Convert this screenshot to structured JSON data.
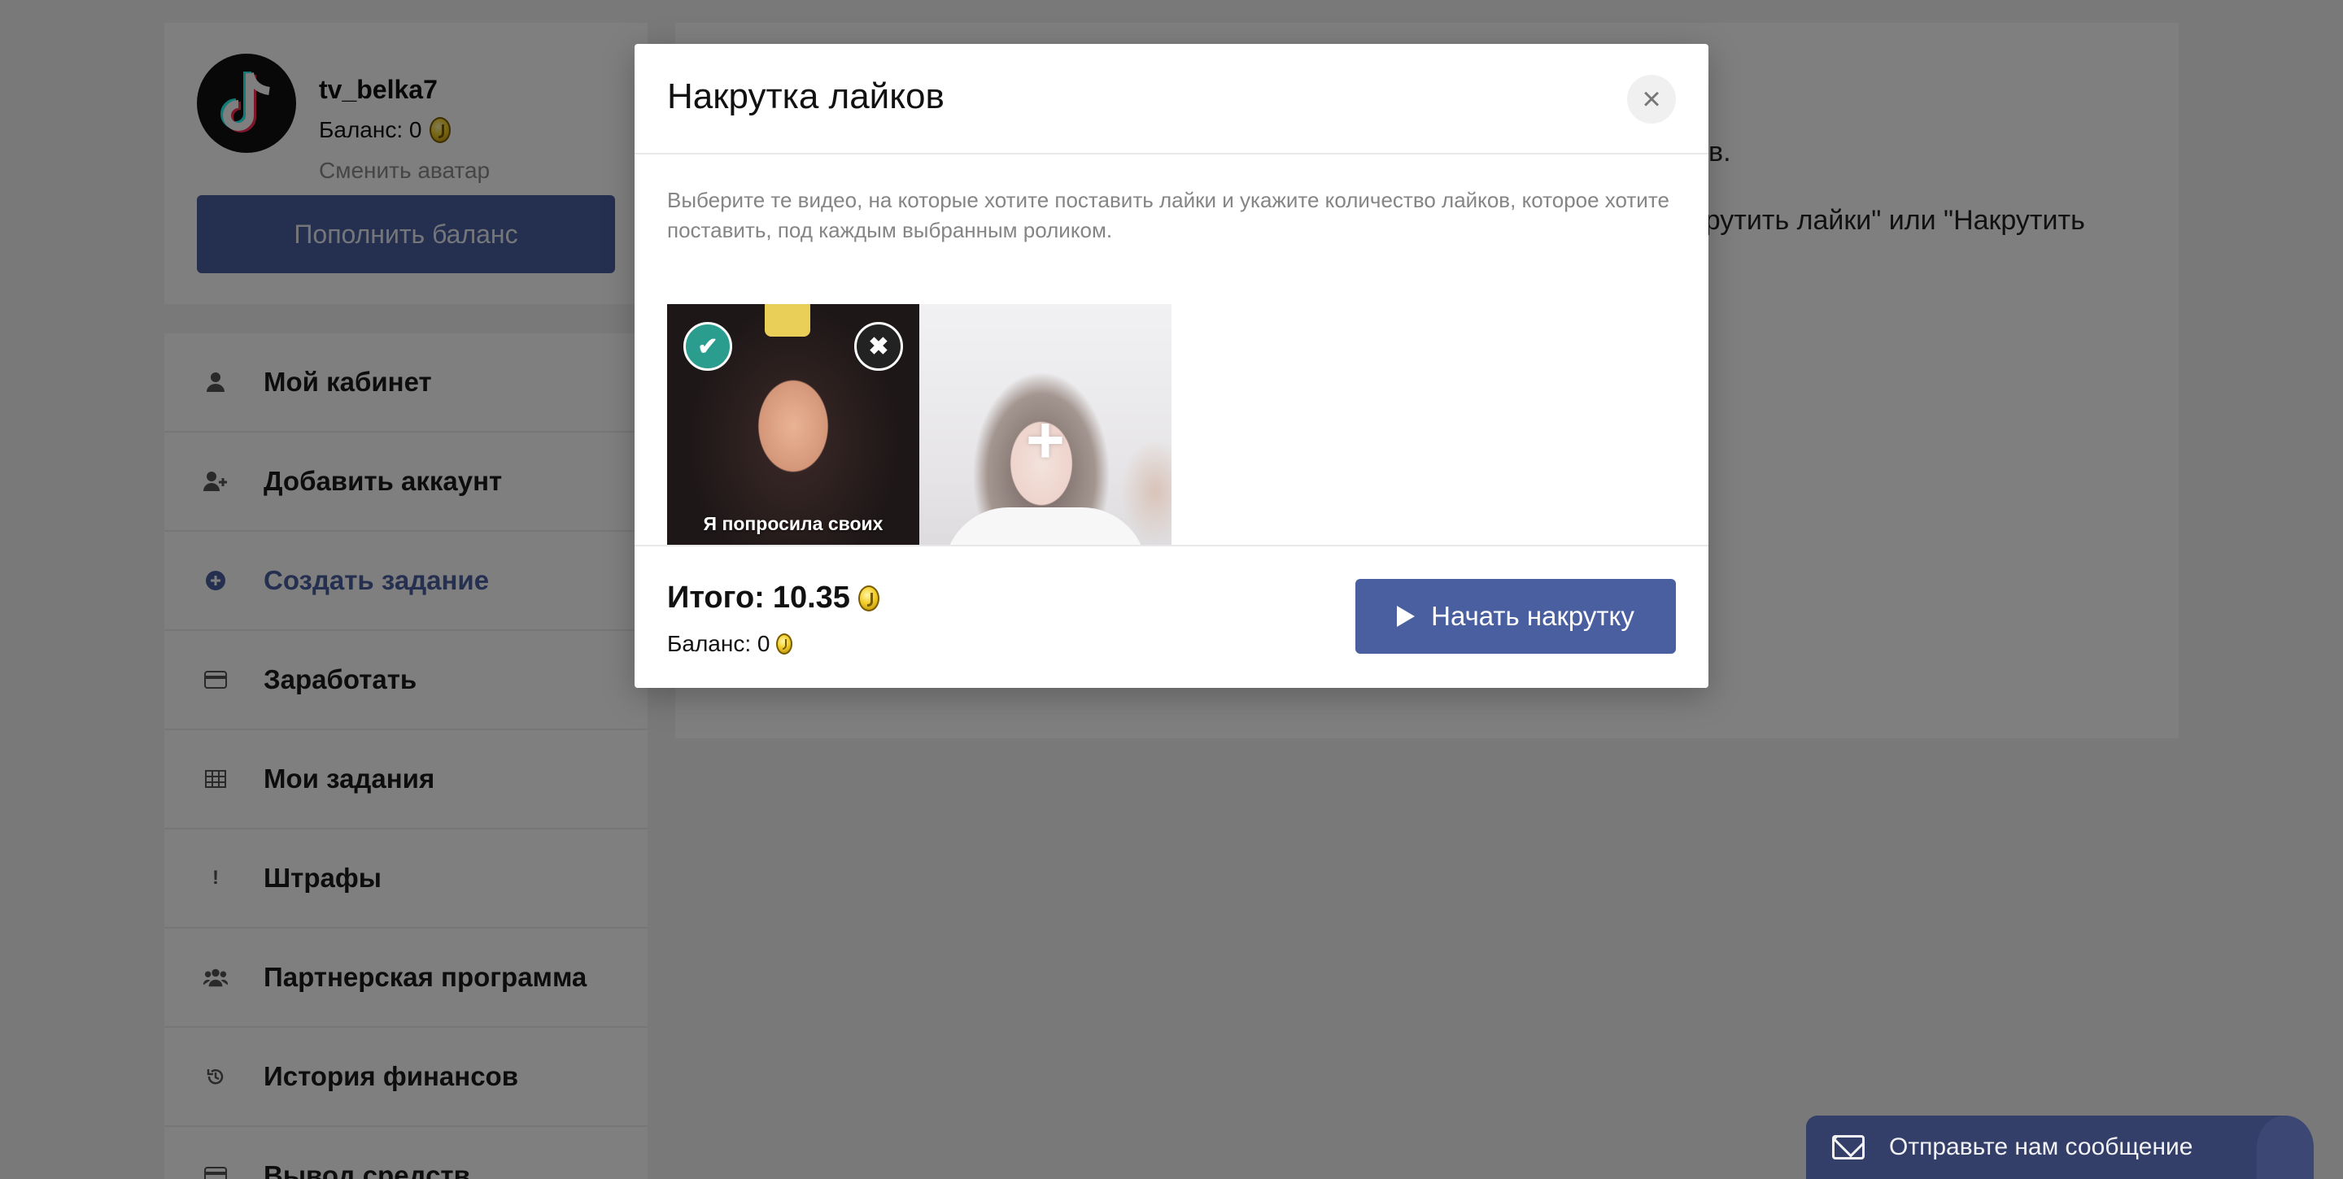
{
  "profile": {
    "username": "tv_belka7",
    "balance_text": "Баланс: 0",
    "change_avatar": "Сменить аватар",
    "topup_button": "Пополнить баланс"
  },
  "menu": {
    "items": [
      {
        "label": "Мой кабинет",
        "icon": "user-icon"
      },
      {
        "label": "Добавить аккаунт",
        "icon": "user-plus-icon"
      },
      {
        "label": "Создать задание",
        "icon": "plus-circle-icon",
        "active": true
      },
      {
        "label": "Заработать",
        "icon": "credit-card-icon"
      },
      {
        "label": "Мои задания",
        "icon": "table-icon"
      },
      {
        "label": "Штрафы",
        "icon": "exclamation-icon"
      },
      {
        "label": "Партнерская программа",
        "icon": "users-icon"
      },
      {
        "label": "История финансов",
        "icon": "history-icon"
      },
      {
        "label": "Вывод средств",
        "icon": "wallet-icon"
      }
    ]
  },
  "main": {
    "fragment_1": "в.",
    "fragment_2": "акрутить лайки\" или \"Накрутить"
  },
  "modal": {
    "title": "Накрутка лайков",
    "close_symbol": "×",
    "instructions": "Выберите те видео, на которые хотите поставить лайки и укажите количество лайков, которое хотите поставить, под каждым выбранным роликом.",
    "videos": [
      {
        "caption": "Я попросила своих друзей, прислать фото",
        "selected": true
      },
      {
        "caption": "",
        "selected": false
      }
    ],
    "total_label": "Итого:",
    "total_value": "10.35",
    "balance_text": "Баланс: 0",
    "start_button": "Начать накрутку"
  },
  "chat": {
    "label": "Отправьте нам сообщение"
  },
  "colors": {
    "accent": "#4a5fa0",
    "selected_badge": "#2a9d8f",
    "chat_bg": "#333f68"
  }
}
